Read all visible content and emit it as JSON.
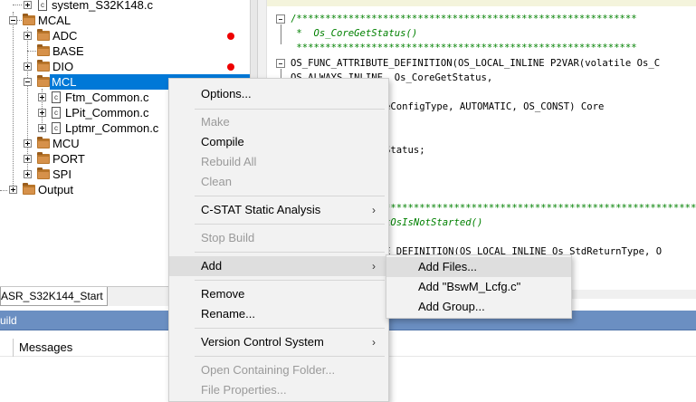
{
  "workspace": {
    "tree": [
      {
        "label": "system_S32K148.c",
        "kind": "file"
      },
      {
        "label": "MCAL",
        "kind": "folder"
      },
      {
        "label": "ADC",
        "kind": "folder",
        "status": "red-dot"
      },
      {
        "label": "BASE",
        "kind": "folder"
      },
      {
        "label": "DIO",
        "kind": "folder",
        "status": "red-dot"
      },
      {
        "label": "MCL",
        "kind": "folder",
        "selected": true
      },
      {
        "label": "Ftm_Common.c",
        "kind": "file"
      },
      {
        "label": "LPit_Common.c",
        "kind": "file"
      },
      {
        "label": "Lptmr_Common.c",
        "kind": "file"
      },
      {
        "label": "MCU",
        "kind": "folder"
      },
      {
        "label": "PORT",
        "kind": "folder"
      },
      {
        "label": "SPI",
        "kind": "folder"
      },
      {
        "label": "Output",
        "kind": "folder"
      }
    ],
    "file_icon_glyph": "c",
    "tab_label": "ASR_S32K144_Start"
  },
  "editor": {
    "lines": [
      "/***********************************************************",
      " *  Os_CoreGetStatus()",
      " ***********************************************************",
      "OS_FUNC_ATTRIBUTE_DEFINITION(OS_LOCAL_INLINE P2VAR(volatile Os_C",
      "OS_ALWAYS_INLINE, Os_CoreGetStatus,",
      "eConfigType, AUTOMATIC, OS_CONST) Core",
      "Status;",
      "***********************************************************",
      "kOsIsNotStarted()",
      "E_DEFINITION(OS_LOCAL_INLINE Os_StdReturnType, O"
    ]
  },
  "bottom": {
    "build_title": "uild",
    "messages_label": "Messages"
  },
  "context_menu": {
    "items": [
      {
        "label": "Options...",
        "enabled": true
      },
      {
        "label": "Make",
        "enabled": false
      },
      {
        "label": "Compile",
        "enabled": true
      },
      {
        "label": "Rebuild All",
        "enabled": false
      },
      {
        "label": "Clean",
        "enabled": false
      },
      {
        "label": "C-STAT Static Analysis",
        "enabled": true,
        "submenu": true
      },
      {
        "label": "Stop Build",
        "enabled": false
      },
      {
        "label": "Add",
        "enabled": true,
        "submenu": true,
        "highlighted": true
      },
      {
        "label": "Remove",
        "enabled": true
      },
      {
        "label": "Rename...",
        "enabled": true
      },
      {
        "label": "Version Control System",
        "enabled": true,
        "submenu": true
      },
      {
        "label": "Open Containing Folder...",
        "enabled": false
      },
      {
        "label": "File Properties...",
        "enabled": false
      }
    ],
    "submenu_arrow": "›"
  },
  "add_submenu": {
    "items": [
      {
        "label": "Add Files...",
        "highlighted": true
      },
      {
        "label": "Add \"BswM_Lcfg.c\""
      },
      {
        "label": "Add Group..."
      }
    ]
  },
  "colors": {
    "selection": "#0078d7",
    "build_header": "#6b8fc2",
    "comment": "#008000",
    "status_dot": "#ee0000",
    "folder": "#b8752a"
  }
}
